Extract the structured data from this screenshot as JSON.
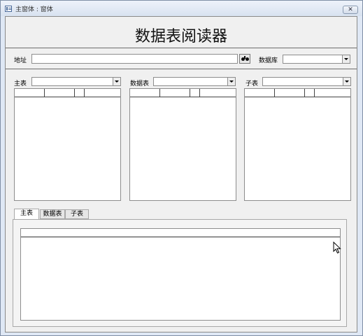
{
  "window": {
    "title": "主窗体 : 窗体",
    "close_symbol": "✕"
  },
  "form": {
    "heading": "数据表阅读器",
    "address_label": "地址",
    "address_value": "",
    "database_label": "数据库",
    "database_value": ""
  },
  "panels": [
    {
      "label": "主表",
      "selected": ""
    },
    {
      "label": "数据表",
      "selected": ""
    },
    {
      "label": "子表",
      "selected": ""
    }
  ],
  "tabs": [
    {
      "label": "主表",
      "active": true
    },
    {
      "label": "数据表",
      "active": false
    },
    {
      "label": "子表",
      "active": false
    }
  ],
  "icons": {
    "window": "form-icon",
    "find": "binoculars-icon",
    "dropdown": "chevron-down-icon",
    "cursor": "mouse-pointer-icon"
  }
}
